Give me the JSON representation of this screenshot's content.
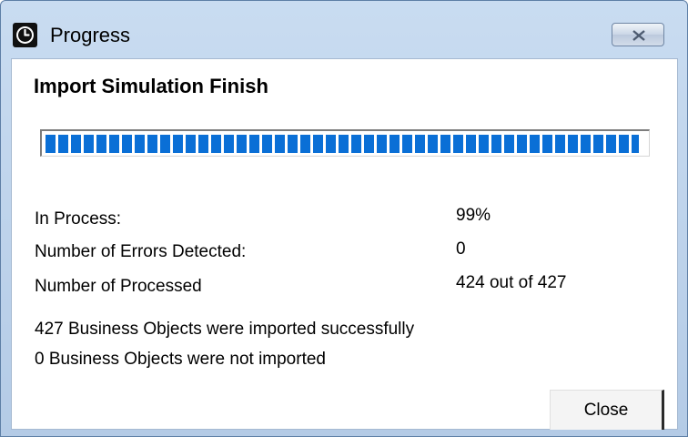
{
  "window": {
    "title": "Progress",
    "icon": "clock-icon",
    "close_icon": "close-icon"
  },
  "dialog": {
    "heading": "Import Simulation Finish",
    "progress_fraction": 0.99
  },
  "stats": [
    {
      "label": "In Process:",
      "value": "99%"
    },
    {
      "label": "Number of Errors Detected:",
      "value": "0"
    },
    {
      "label": "Number of Processed",
      "value": "424 out of 427"
    }
  ],
  "summary": [
    "427 Business Objects were imported successfully",
    "0 Business Objects were not imported"
  ],
  "buttons": {
    "close_label": "Close"
  },
  "colors": {
    "progress_fill": "#0a6fd6",
    "title_bar": "#c9dcf1"
  }
}
